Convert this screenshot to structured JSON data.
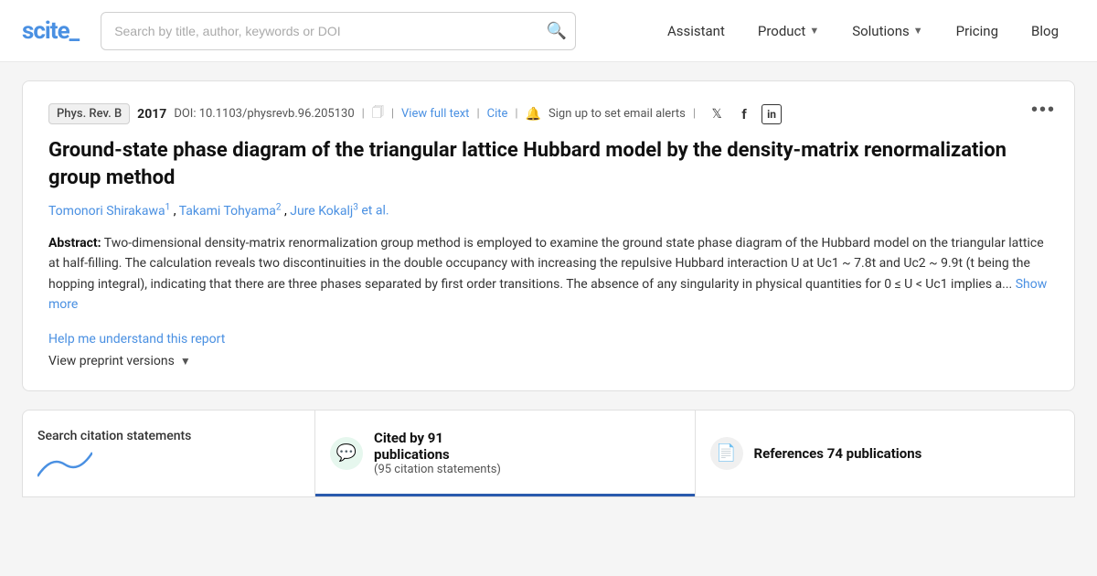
{
  "nav": {
    "logo_text": "scite_",
    "search_placeholder": "Search by title, author, keywords or DOI",
    "links": [
      {
        "label": "Assistant",
        "has_chevron": false
      },
      {
        "label": "Product",
        "has_chevron": true
      },
      {
        "label": "Solutions",
        "has_chevron": true
      },
      {
        "label": "Pricing",
        "has_chevron": false
      },
      {
        "label": "Blog",
        "has_chevron": false
      }
    ]
  },
  "paper": {
    "journal": "Phys. Rev. B",
    "year": "2017",
    "doi": "DOI: 10.1103/physrevb.96.205130",
    "view_full_text": "View full text",
    "cite": "Cite",
    "alert_text": "Sign up to set email alerts",
    "title": "Ground-state phase diagram of the triangular lattice Hubbard model by the density-matrix renormalization group method",
    "authors": [
      {
        "name": "Tomonori Shirakawa",
        "sup": "1"
      },
      {
        "name": "Takami Tohyama",
        "sup": "2"
      },
      {
        "name": "Jure Kokalj",
        "sup": "3"
      }
    ],
    "et_al": "et al.",
    "abstract_label": "Abstract:",
    "abstract_text": "Two-dimensional density-matrix renormalization group method is employed to examine the ground state phase diagram of the Hubbard model on the triangular lattice at half-filling. The calculation reveals two discontinuities in the double occupancy with increasing the repulsive Hubbard interaction U at Uc1 ~ 7.8t and Uc2 ~ 9.9t (t being the hopping integral), indicating that there are three phases separated by first order transitions. The absence of any singularity in physical quantities for 0 ≤ U < Uc1 implies a...",
    "show_more": "Show more",
    "help_link": "Help me understand this report",
    "preprint_label": "View preprint versions",
    "more_icon": "•••"
  },
  "bottom_tabs": {
    "search_label": "Search citation statements",
    "cited_by_main": "Cited by 91",
    "cited_by_sub": "publications",
    "citations_sub": "(95 citation statements)",
    "references_main": "References 74 publications"
  },
  "icons": {
    "search": "🔍",
    "bell": "🔔",
    "twitter": "𝕏",
    "facebook": "f",
    "linkedin": "in",
    "chat_bubble": "💬",
    "document": "📄"
  }
}
